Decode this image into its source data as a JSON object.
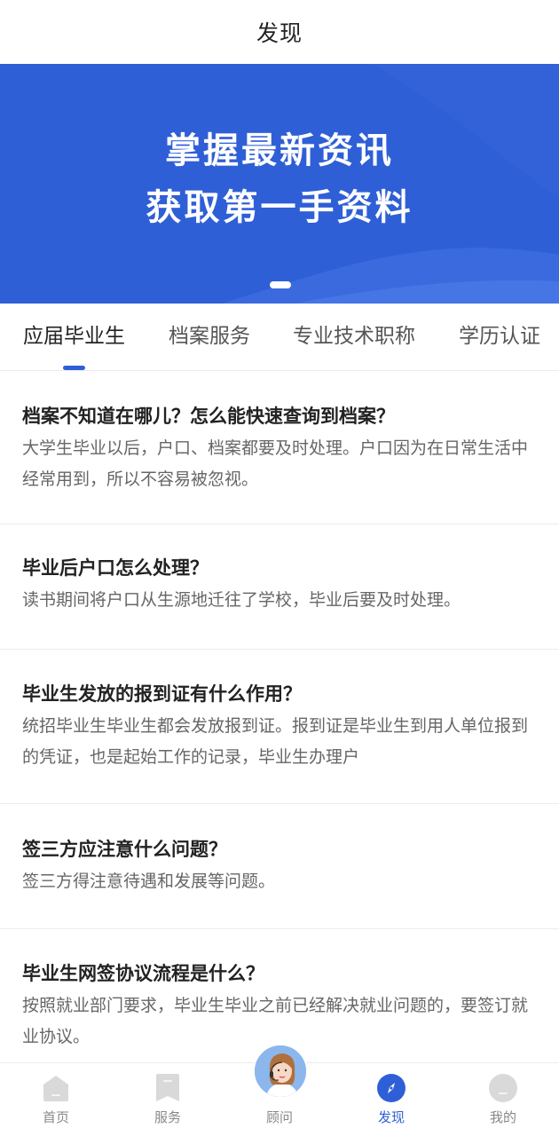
{
  "header": {
    "title": "发现"
  },
  "banner": {
    "line1": "掌握最新资讯",
    "line2": "获取第一手资料",
    "bg_color": "#2f5fd6"
  },
  "tabs": [
    {
      "label": "应届毕业生",
      "active": true
    },
    {
      "label": "档案服务",
      "active": false
    },
    {
      "label": "专业技术职称",
      "active": false
    },
    {
      "label": "学历认证",
      "active": false
    }
  ],
  "articles": [
    {
      "title": "档案不知道在哪儿？怎么能快速查询到档案？",
      "summary": "大学生毕业以后，户口、档案都要及时处理。户口因为在日常生活中经常用到，所以不容易被忽视。"
    },
    {
      "title": "毕业后户口怎么处理？",
      "summary": "读书期间将户口从生源地迁往了学校，毕业后要及时处理。"
    },
    {
      "title": "毕业生发放的报到证有什么作用？",
      "summary": "统招毕业生毕业生都会发放报到证。报到证是毕业生到用人单位报到的凭证，也是起始工作的记录，毕业生办理户"
    },
    {
      "title": "签三方应注意什么问题？",
      "summary": "签三方得注意待遇和发展等问题。"
    },
    {
      "title": "毕业生网签协议流程是什么？",
      "summary": "按照就业部门要求，毕业生毕业之前已经解决就业问题的，要签订就业协议。"
    }
  ],
  "tabbar": {
    "items": [
      {
        "label": "首页",
        "icon": "home-icon",
        "active": false
      },
      {
        "label": "服务",
        "icon": "bookmark-icon",
        "active": false
      },
      {
        "label": "顾问",
        "icon": "advisor-avatar",
        "active": false
      },
      {
        "label": "发现",
        "icon": "compass-icon",
        "active": true
      },
      {
        "label": "我的",
        "icon": "profile-icon",
        "active": false
      }
    ]
  },
  "colors": {
    "accent": "#2f5fd6",
    "inactive_icon": "#d9d9d9",
    "divider": "#ececec"
  }
}
